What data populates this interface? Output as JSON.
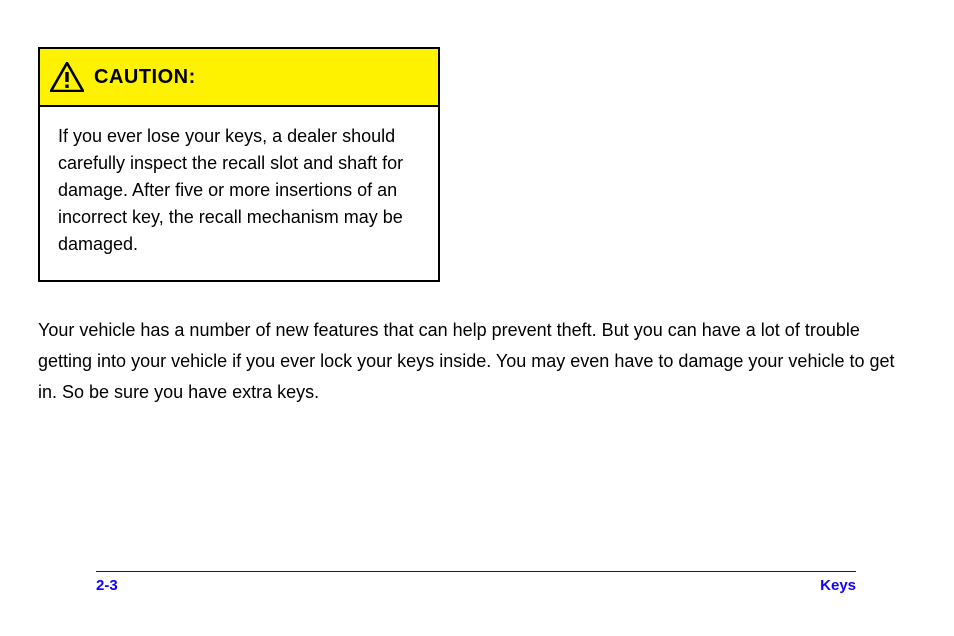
{
  "caution": {
    "title": "CAUTION:",
    "body": "If you ever lose your keys, a dealer should carefully inspect the recall slot and shaft for damage. After five or more insertions of an incorrect key, the recall mechanism may be damaged."
  },
  "main_paragraph": "Your vehicle has a number of new features that can help prevent theft. But you can have a lot of trouble getting into your vehicle if you ever lock your keys inside. You may even have to damage your vehicle to get in. So be sure you have extra keys.",
  "footer": {
    "page": "2-3",
    "section": "Keys"
  }
}
